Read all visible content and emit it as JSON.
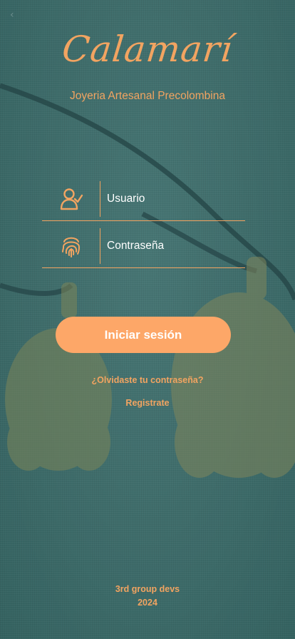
{
  "app": {
    "title": "Calamarí",
    "subtitle": "Joyeria Artesanal Precolombina"
  },
  "form": {
    "user_label": "Usuario",
    "password_label": "Contraseña",
    "login_button": "Iniciar sesión",
    "forgot_link": "¿Olvidaste tu contraseña?",
    "register_link": "Registrate"
  },
  "footer": {
    "line1": "3rd group devs",
    "line2": "2024"
  },
  "icons": {
    "back": "chevron-left-icon",
    "user": "user-check-icon",
    "password": "fingerprint-icon"
  },
  "colors": {
    "accent": "#f2a461",
    "button": "#fda768",
    "background": "#3f6d6c",
    "text_light": "#ffffff"
  }
}
